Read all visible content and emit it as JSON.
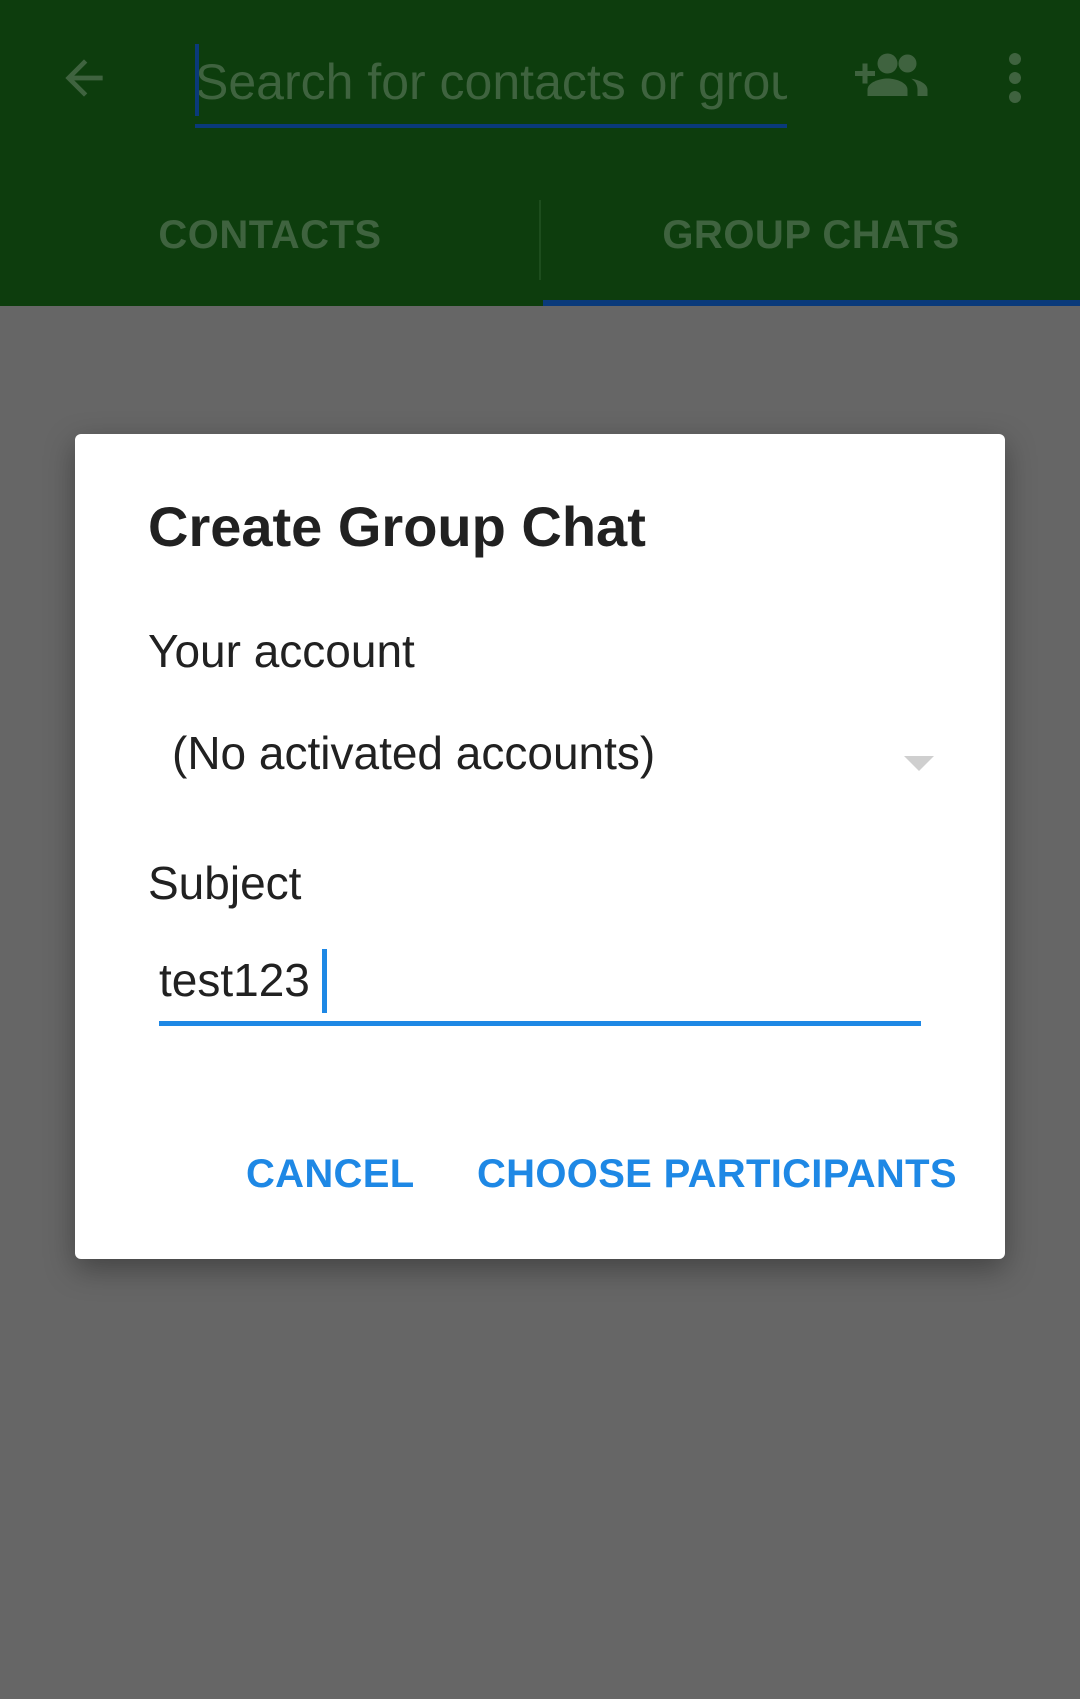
{
  "toolbar": {
    "search_placeholder": "Search for contacts or group chats",
    "back_icon": "arrow-back-icon",
    "add_group_icon": "group-add-icon",
    "overflow_icon": "more-vert-icon"
  },
  "tabs": [
    {
      "label": "CONTACTS",
      "selected": false
    },
    {
      "label": "GROUP CHATS",
      "selected": true
    }
  ],
  "dialog": {
    "title": "Create Group Chat",
    "account_label": "Your account",
    "account_value": "(No activated accounts)",
    "subject_label": "Subject",
    "subject_value": "test123",
    "cancel_label": "CANCEL",
    "choose_label": "CHOOSE PARTICIPANTS"
  },
  "colors": {
    "appbar": "#0d3d0d",
    "scrim": "#666666",
    "accent": "#1e88e5"
  }
}
